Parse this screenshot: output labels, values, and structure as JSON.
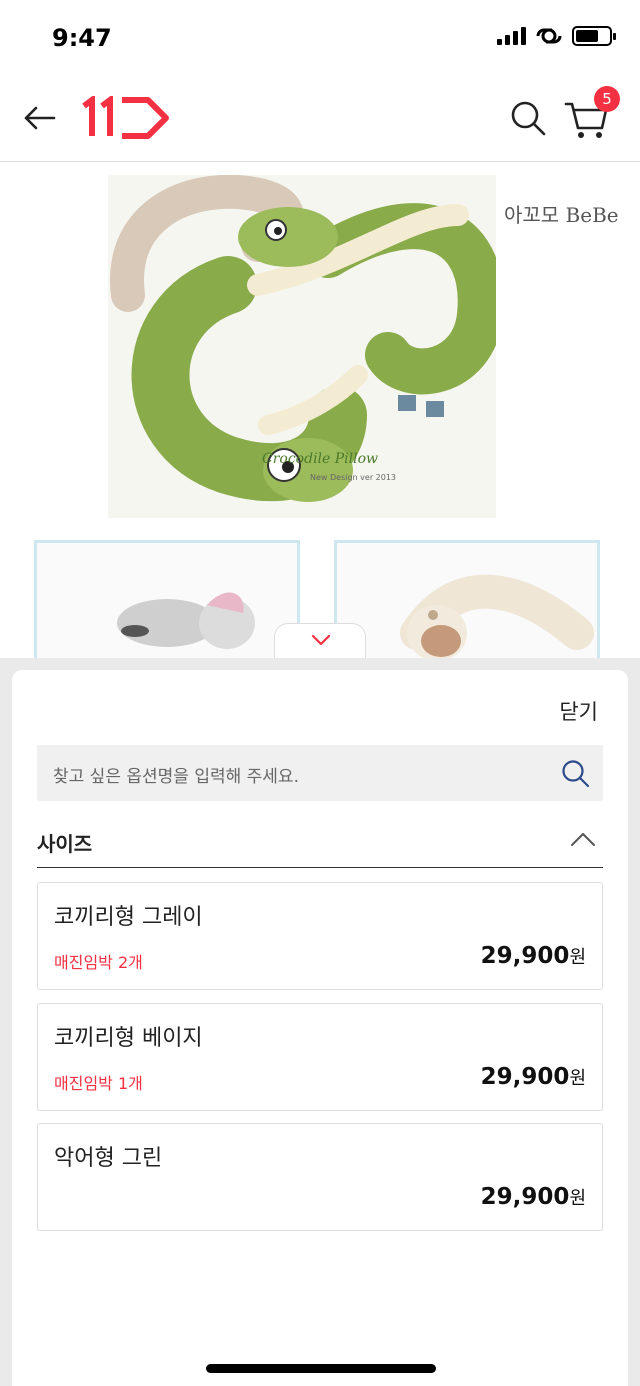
{
  "status_bar": {
    "time": "9:47"
  },
  "header": {
    "logo_text": "11",
    "cart_count": "5"
  },
  "product": {
    "brand_text": "아꼬모 BeBe",
    "image_caption": "Crocodile Pillow",
    "image_caption_sub": "New Design ver 2013"
  },
  "option_sheet": {
    "close_label": "닫기",
    "search_placeholder": "찾고 싶은 옵션명을 입력해 주세요.",
    "section_title": "사이즈",
    "currency_unit": "원",
    "options": [
      {
        "name": "코끼리형 그레이",
        "stock": "매진임박 2개",
        "price": "29,900"
      },
      {
        "name": "코끼리형 베이지",
        "stock": "매진임박 1개",
        "price": "29,900"
      },
      {
        "name": "악어형 그린",
        "stock": "",
        "price": "29,900"
      }
    ]
  },
  "colors": {
    "accent": "#f43142",
    "overlay": "#eaeaea"
  }
}
